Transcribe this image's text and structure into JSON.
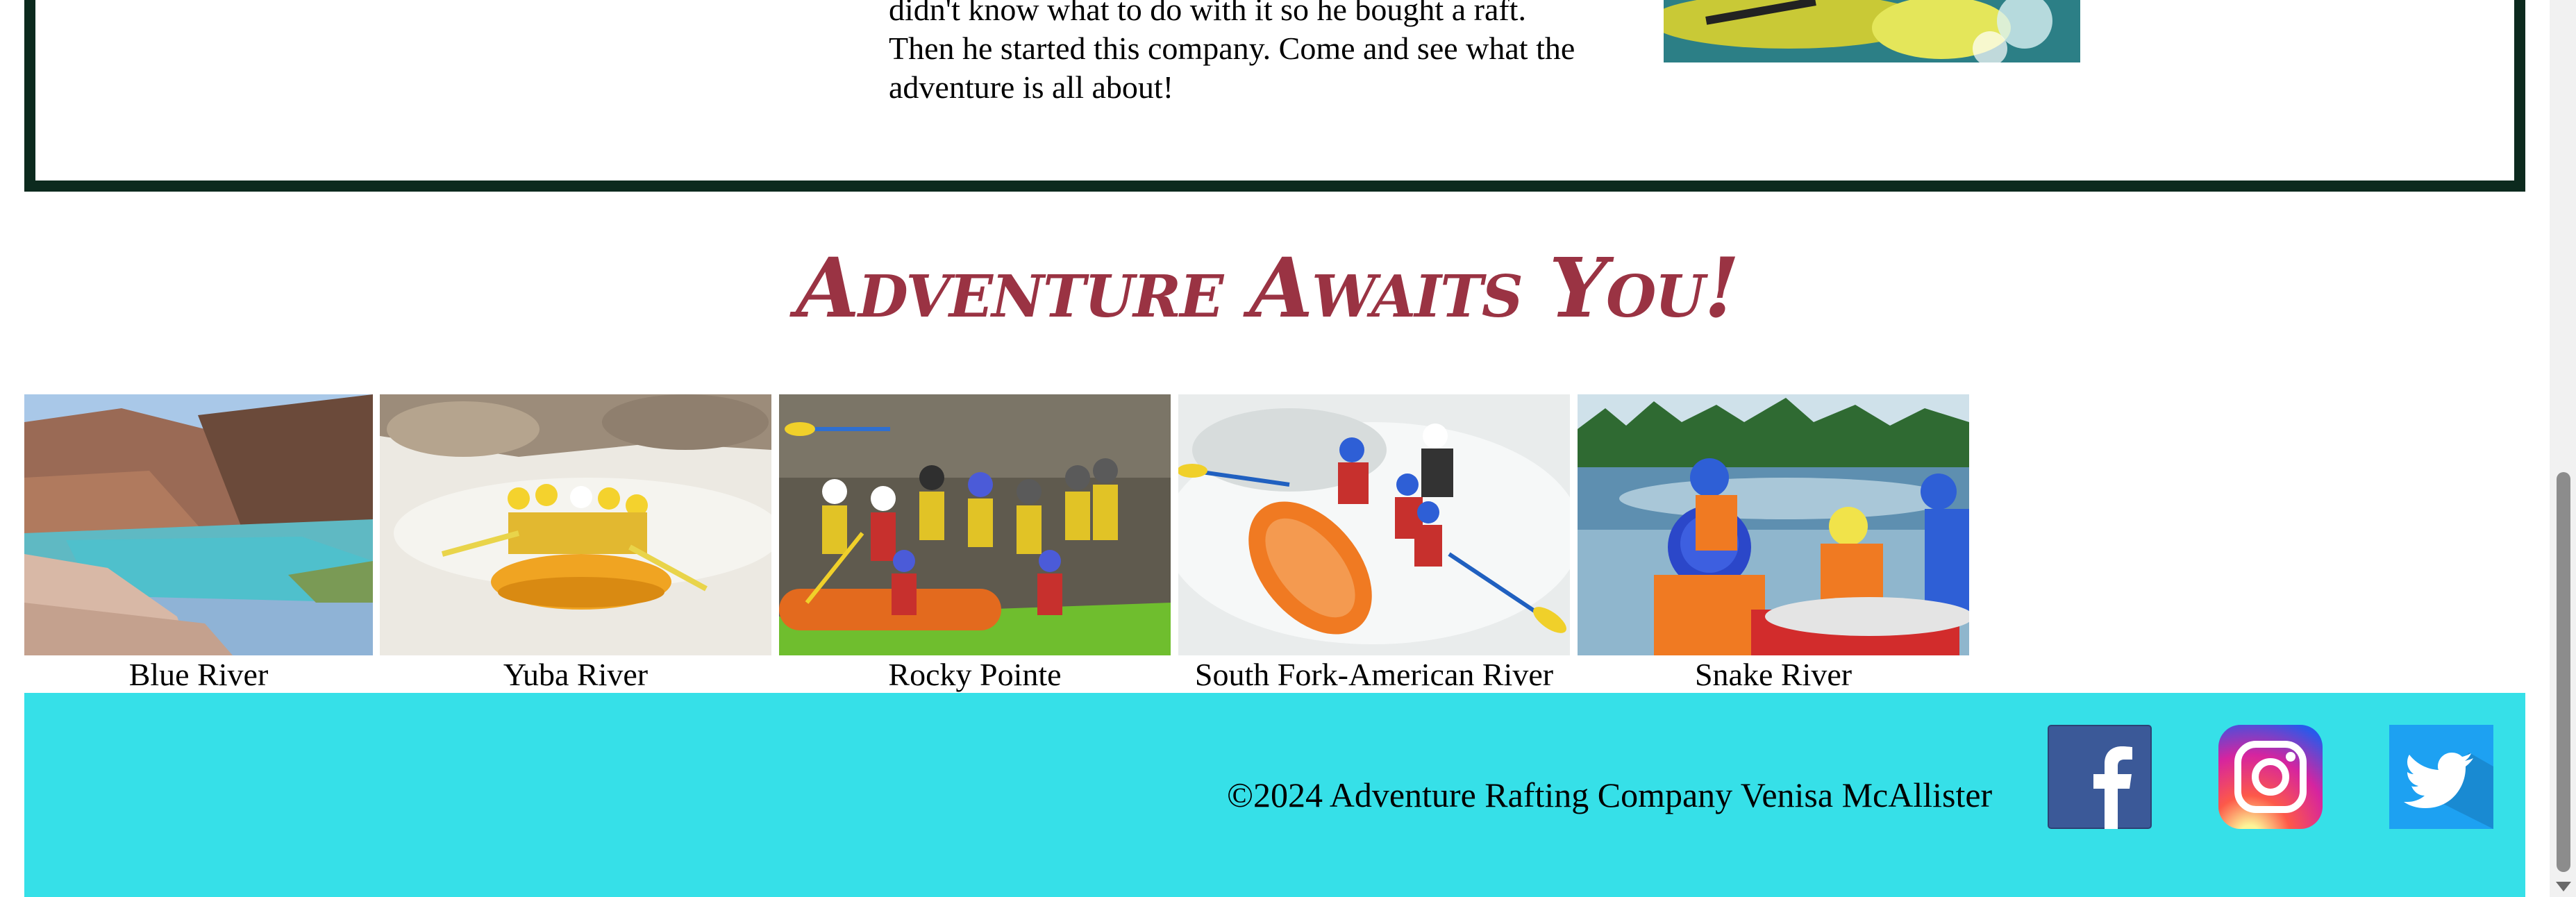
{
  "about": {
    "line1": "didn't know what to do with it so he bought a raft.",
    "line2": "Then he started this company. Come and see what the",
    "line3": "adventure is all about!"
  },
  "heading": "Adventure Awaits You!",
  "gallery": [
    {
      "caption": "Blue River"
    },
    {
      "caption": "Yuba River"
    },
    {
      "caption": "Rocky Pointe"
    },
    {
      "caption": "South Fork-American River"
    },
    {
      "caption": "Snake River"
    }
  ],
  "footer": {
    "copyright": "©2024 Adventure Rafting Company Venisa McAllister",
    "social": [
      {
        "icon": "facebook-icon",
        "color": "#3b5998"
      },
      {
        "icon": "instagram-icon",
        "color": "#d6249f"
      },
      {
        "icon": "twitter-icon",
        "color": "#1da1f2"
      }
    ],
    "background": "#36e0e8"
  },
  "colors": {
    "heading": "#9a3343",
    "border": "#0c2a1e"
  }
}
